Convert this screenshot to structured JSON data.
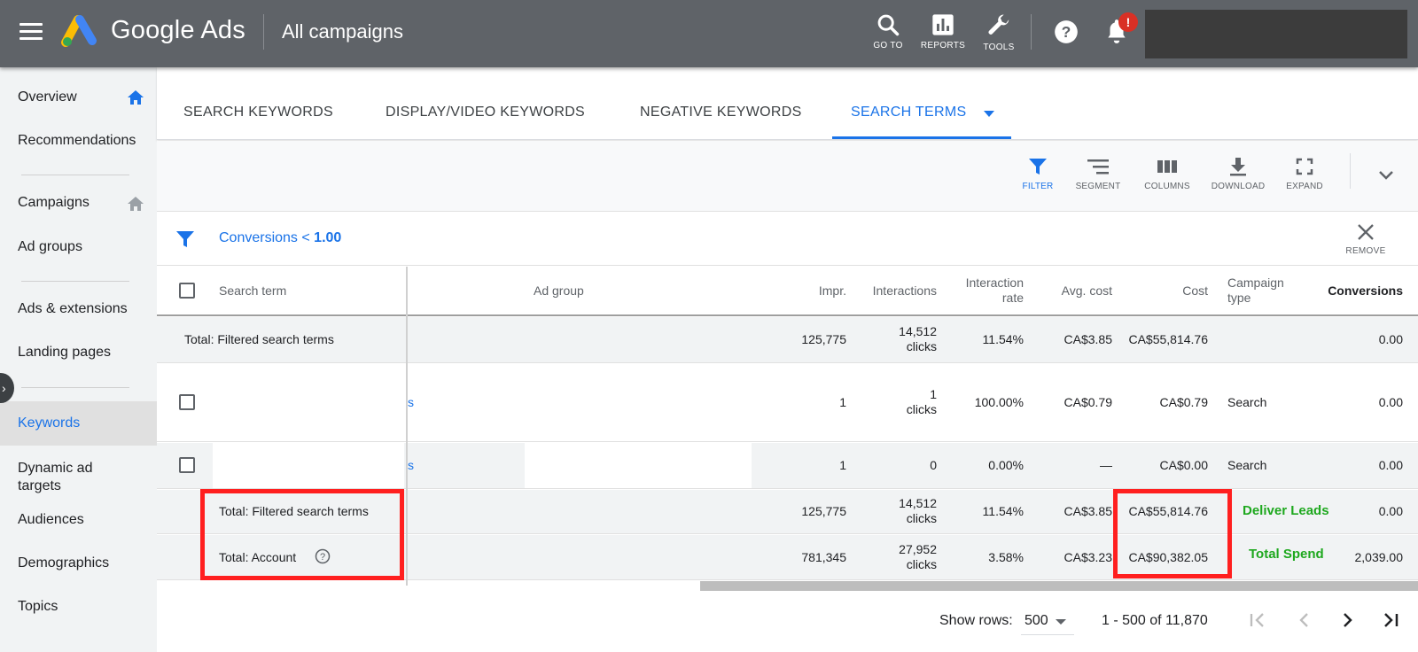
{
  "topbar": {
    "brand": "Google Ads",
    "view_title": "All campaigns",
    "tools": [
      "GO TO",
      "REPORTS",
      "TOOLS"
    ],
    "notification_badge": "!"
  },
  "sidebar": {
    "items": [
      "Overview",
      "Recommendations",
      "Campaigns",
      "Ad groups",
      "Ads & extensions",
      "Landing pages",
      "Keywords",
      "Dynamic ad",
      "targets",
      "Audiences",
      "Demographics",
      "Topics"
    ]
  },
  "tabs": [
    "SEARCH KEYWORDS",
    "DISPLAY/VIDEO KEYWORDS",
    "NEGATIVE KEYWORDS",
    "SEARCH TERMS"
  ],
  "toolbar": [
    "FILTER",
    "SEGMENT",
    "COLUMNS",
    "DOWNLOAD",
    "EXPAND"
  ],
  "filter": {
    "label": "Conversions <",
    "value": "1.00",
    "remove_label": "REMOVE"
  },
  "table": {
    "headers": {
      "search_term": "Search term",
      "ad_group": "Ad group",
      "impr": "Impr.",
      "interactions": "Interactions",
      "interaction_rate_1": "Interaction",
      "interaction_rate_2": "rate",
      "avg_cost": "Avg. cost",
      "cost": "Cost",
      "campaign_type_1": "Campaign",
      "campaign_type_2": "type",
      "conversions": "Conversions"
    },
    "total_top": {
      "label": "Total: Filtered search terms",
      "impr": "125,775",
      "interactions_1": "14,512",
      "interactions_2": "clicks",
      "rate": "11.54%",
      "avg_cost": "CA$3.85",
      "cost": "CA$55,814.76",
      "conversions": "0.00"
    },
    "rows": [
      {
        "term_fragment": "s",
        "impr": "1",
        "interactions_1": "1",
        "interactions_2": "clicks",
        "rate": "100.00%",
        "avg_cost": "CA$0.79",
        "cost": "CA$0.79",
        "type": "Search",
        "conversions": "0.00"
      },
      {
        "term_fragment": "s",
        "impr": "1",
        "interactions_1": "0",
        "interactions_2": "",
        "rate": "0.00%",
        "avg_cost": "—",
        "cost": "CA$0.00",
        "type": "Search",
        "conversions": "0.00"
      }
    ],
    "total_filtered": {
      "label": "Total: Filtered search terms",
      "impr": "125,775",
      "interactions_1": "14,512",
      "interactions_2": "clicks",
      "rate": "11.54%",
      "avg_cost": "CA$3.85",
      "cost": "CA$55,814.76",
      "annotation": "Deliver Leads",
      "conversions": "0.00"
    },
    "total_account": {
      "label": "Total: Account",
      "impr": "781,345",
      "interactions_1": "27,952",
      "interactions_2": "clicks",
      "rate": "3.58%",
      "avg_cost": "CA$3.23",
      "cost": "CA$90,382.05",
      "annotation": "Total Spend",
      "conversions": "2,039.00"
    }
  },
  "footer": {
    "show_rows_label": "Show rows:",
    "show_rows_value": "500",
    "range": "1 - 500 of 11,870"
  },
  "colors": {
    "accent": "#1a73e8",
    "topbar": "#5f6368",
    "annotation": "#1ea81e",
    "highlight": "#ff1f1f"
  }
}
